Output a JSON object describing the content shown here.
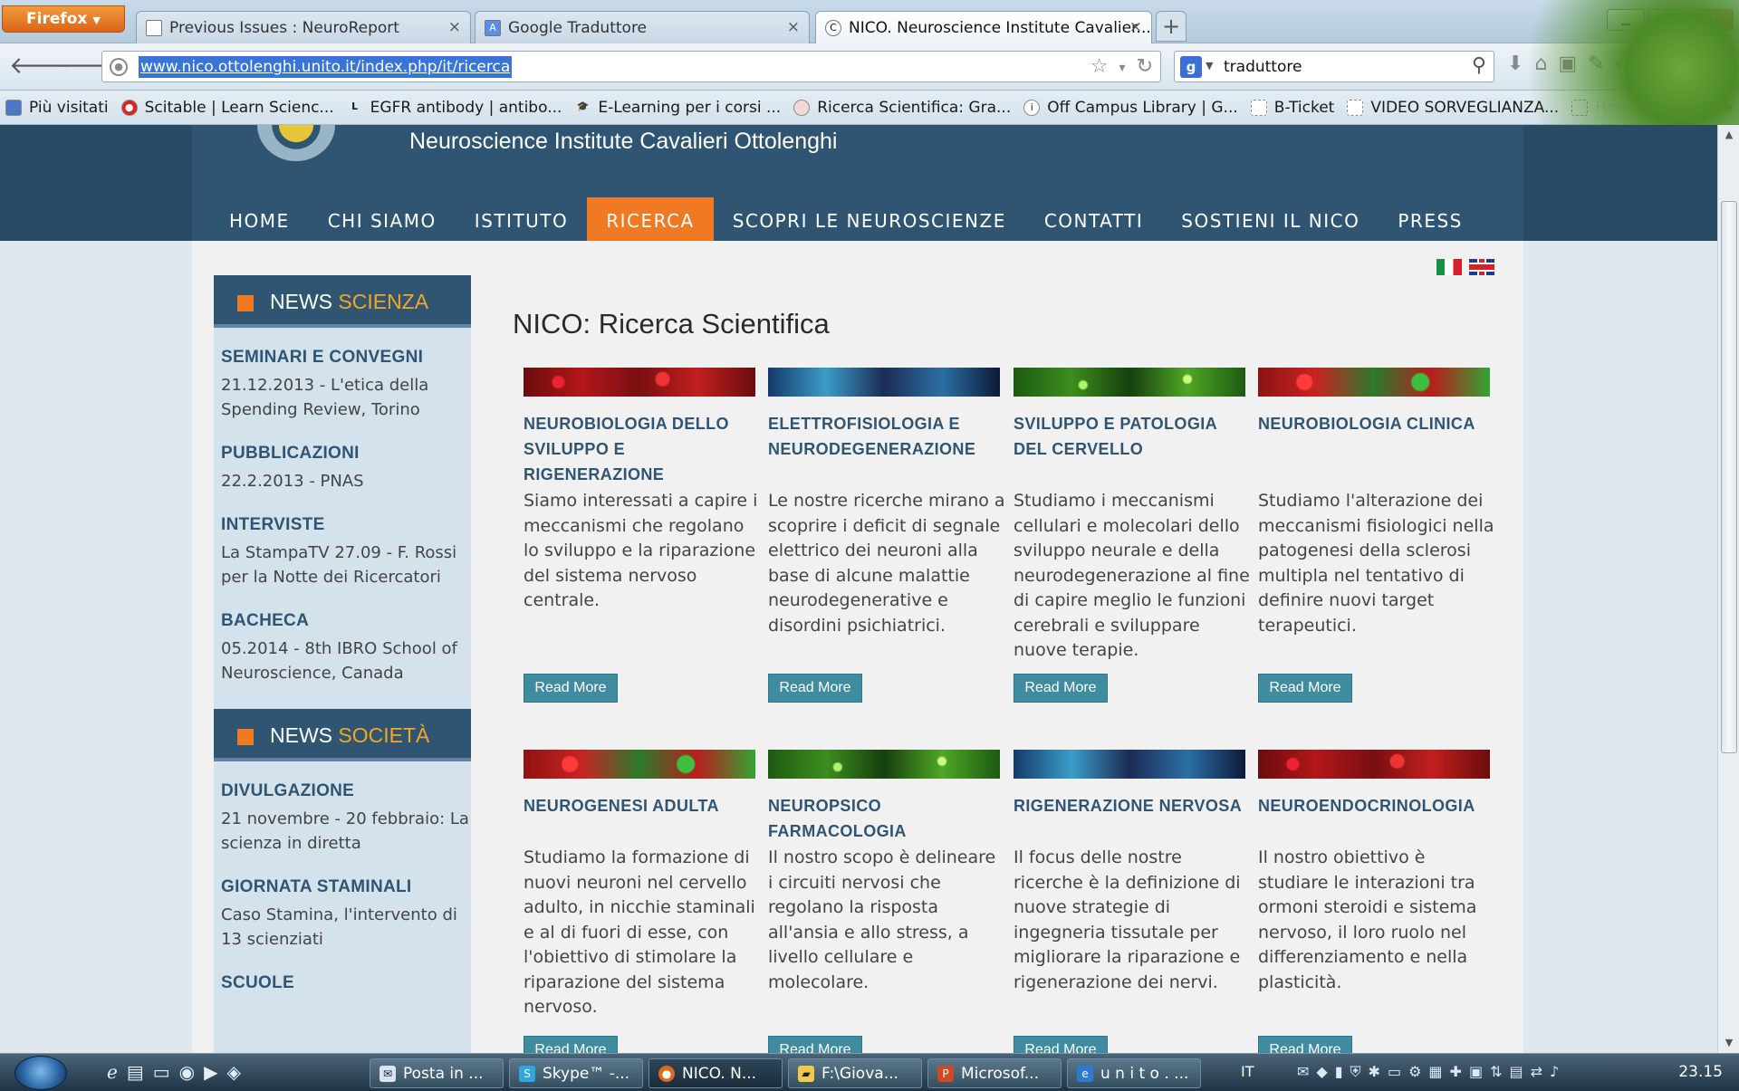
{
  "browser": {
    "menu_button": "Firefox",
    "tabs": [
      {
        "title": "Previous Issues : NeuroReport",
        "active": false
      },
      {
        "title": "Google Traduttore",
        "active": false
      },
      {
        "title": "NICO. Neuroscience Institute Cavalier...",
        "active": true
      }
    ],
    "new_tab": "+",
    "url": "www.nico.ottolenghi.unito.it/index.php/it/ricerca",
    "search_engine": "g",
    "search_value": "traduttore",
    "bookmarks": [
      {
        "label": "Più visitati",
        "icon": "star-folder-icon"
      },
      {
        "label": "Scitable | Learn Scienc...",
        "icon": "scitable-icon"
      },
      {
        "label": "EGFR antibody | antibo...",
        "icon": "l-icon"
      },
      {
        "label": "E-Learning per i corsi ...",
        "icon": "graduation-cap-icon"
      },
      {
        "label": "Ricerca Scientifica: Gra...",
        "icon": "site-icon"
      },
      {
        "label": "Off Campus Library | G...",
        "icon": "info-icon"
      },
      {
        "label": "B-Ticket",
        "icon": "page-icon"
      },
      {
        "label": "VIDEO SORVEGLIANZA...",
        "icon": "page-icon"
      },
      {
        "label": "Home page - LICEO S...",
        "icon": "page-icon"
      }
    ],
    "bookmarks_more": "»"
  },
  "site": {
    "title": "Neuroscience Institute Cavalieri Ottolenghi",
    "nav": [
      {
        "label": "HOME",
        "active": false
      },
      {
        "label": "CHI SIAMO",
        "active": false
      },
      {
        "label": "ISTITUTO",
        "active": false
      },
      {
        "label": "RICERCA",
        "active": true
      },
      {
        "label": "SCOPRI LE NEUROSCIENZE",
        "active": false
      },
      {
        "label": "CONTATTI",
        "active": false
      },
      {
        "label": "SOSTIENI IL NICO",
        "active": false
      },
      {
        "label": "PRESS",
        "active": false
      }
    ],
    "languages": [
      "it",
      "en"
    ]
  },
  "sidebar": {
    "news_scienza": {
      "title_a": "NEWS",
      "title_b": "SCIENZA",
      "items": [
        {
          "title": "SEMINARI E CONVEGNI",
          "text": "21.12.2013 - L'etica della Spending Review, Torino"
        },
        {
          "title": "PUBBLICAZIONI",
          "text": "22.2.2013 - PNAS"
        },
        {
          "title": "INTERVISTE",
          "text": "La StampaTV 27.09 - F. Rossi per la Notte dei Ricercatori"
        },
        {
          "title": "BACHECA",
          "text": "05.2014 - 8th IBRO School of Neuroscience, Canada"
        }
      ]
    },
    "news_societa": {
      "title_a": "NEWS",
      "title_b": "SOCIETÀ",
      "items": [
        {
          "title": "DIVULGAZIONE",
          "text": "21 novembre - 20 febbraio: La scienza in diretta"
        },
        {
          "title": "GIORNATA STAMINALI",
          "text": "Caso Stamina, l'intervento di 13 scienziati"
        },
        {
          "title": "SCUOLE",
          "text": ""
        }
      ]
    }
  },
  "main": {
    "title": "NICO: Ricerca Scientifica",
    "read_more": "Read More",
    "cards": [
      {
        "title": "NEUROBIOLOGIA DELLO SVILUPPO E RIGENERAZIONE",
        "text": "Siamo interessati a capire i meccanismi che regolano lo sviluppo e la riparazione del sistema nervoso centrale.",
        "image": "red"
      },
      {
        "title": "ELETTROFISIOLOGIA E NEURODEGENERAZIONE",
        "text": "Le nostre ricerche mirano a scoprire i deficit di segnale elettrico dei neuroni alla base di alcune malattie neurodegenerative e disordini psichiatrici.",
        "image": "blue"
      },
      {
        "title": "SVILUPPO E PATOLOGIA DEL CERVELLO",
        "text": "Studiamo i meccanismi cellulari e molecolari dello sviluppo neurale e della neurodegenerazione al fine di capire meglio le funzioni cerebrali e sviluppare nuove terapie.",
        "image": "green"
      },
      {
        "title": "NEUROBIOLOGIA CLINICA",
        "text": "Studiamo l'alterazione dei meccanismi fisiologici nella patogenesi della sclerosi multipla nel tentativo di definire nuovi target terapeutici.",
        "image": "mixed"
      },
      {
        "title": "NEUROGENESI ADULTA",
        "text": "Studiamo la formazione di nuovi neuroni nel cervello adulto, in nicchie staminali e al di fuori di esse, con l'obiettivo di stimolare la riparazione del sistema nervoso.",
        "image": "mixed"
      },
      {
        "title": "NEUROPSICO FARMACOLOGIA",
        "text": "Il nostro scopo è delineare i circuiti nervosi che regolano la risposta all'ansia e allo stress, a livello cellulare e molecolare.",
        "image": "green"
      },
      {
        "title": "RIGENERAZIONE NERVOSA",
        "text": "Il focus delle nostre ricerche è la definizione di nuove strategie di ingegneria tissutale per migliorare la riparazione e rigenerazione dei nervi.",
        "image": "blue"
      },
      {
        "title": "NEUROENDOCRINOLOGIA",
        "text": "Il nostro obiettivo è studiare le interazioni tra ormoni steroidi e sistema nervoso, il loro ruolo nel differenziamento e nella plasticità.",
        "image": "red"
      }
    ]
  },
  "taskbar": {
    "items": [
      {
        "label": "Posta in ...",
        "icon": "mail-icon"
      },
      {
        "label": "Skype™ -...",
        "icon": "skype-icon"
      },
      {
        "label": "NICO. N...",
        "icon": "firefox-icon",
        "active": true
      },
      {
        "label": "F:\\Giova...",
        "icon": "folder-icon"
      },
      {
        "label": "Microsof...",
        "icon": "powerpoint-icon"
      },
      {
        "label": "u n i t o . ...",
        "icon": "ie-icon"
      }
    ],
    "language": "IT",
    "clock": "23.15"
  },
  "colors": {
    "header": "#2f5573",
    "accent": "#f07a23",
    "button": "#3f8b9f"
  }
}
